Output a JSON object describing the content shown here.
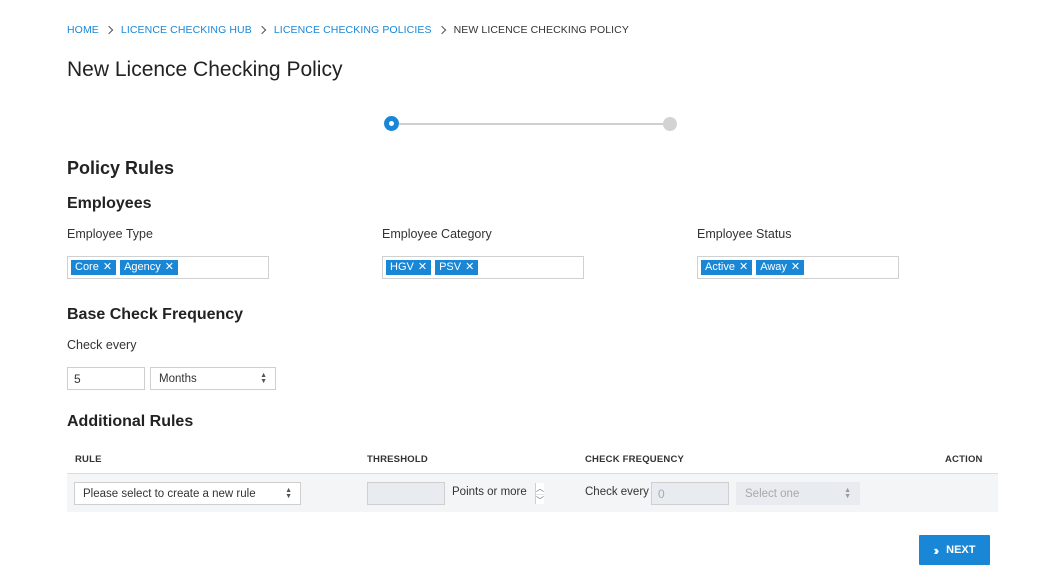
{
  "breadcrumb": {
    "items": [
      "HOME",
      "LICENCE CHECKING HUB",
      "LICENCE CHECKING POLICIES"
    ],
    "current": "NEW LICENCE CHECKING POLICY"
  },
  "page_title": "New Licence Checking Policy",
  "stepper": {
    "current_step": 1,
    "total_steps": 2
  },
  "policy_rules": {
    "title": "Policy Rules",
    "employees": {
      "title": "Employees",
      "employee_type": {
        "label": "Employee Type",
        "tags": [
          "Core",
          "Agency"
        ]
      },
      "employee_category": {
        "label": "Employee Category",
        "tags": [
          "HGV",
          "PSV"
        ]
      },
      "employee_status": {
        "label": "Employee Status",
        "tags": [
          "Active",
          "Away"
        ]
      }
    },
    "base_check": {
      "title": "Base Check Frequency",
      "label": "Check every",
      "value": "5",
      "unit": "Months"
    },
    "additional_rules": {
      "title": "Additional Rules",
      "columns": [
        "RULE",
        "THRESHOLD",
        "CHECK FREQUENCY",
        "ACTION"
      ],
      "row": {
        "rule_select": "Please select to create a new rule",
        "threshold_value": "",
        "threshold_suffix": "Points or more",
        "check_label": "Check every",
        "check_value": "0",
        "check_unit": "Select one"
      }
    }
  },
  "next_button": "NEXT",
  "colors": {
    "accent": "#1a87d6",
    "disabled_bg": "#e8ebef",
    "row_bg": "#f4f5f7"
  }
}
